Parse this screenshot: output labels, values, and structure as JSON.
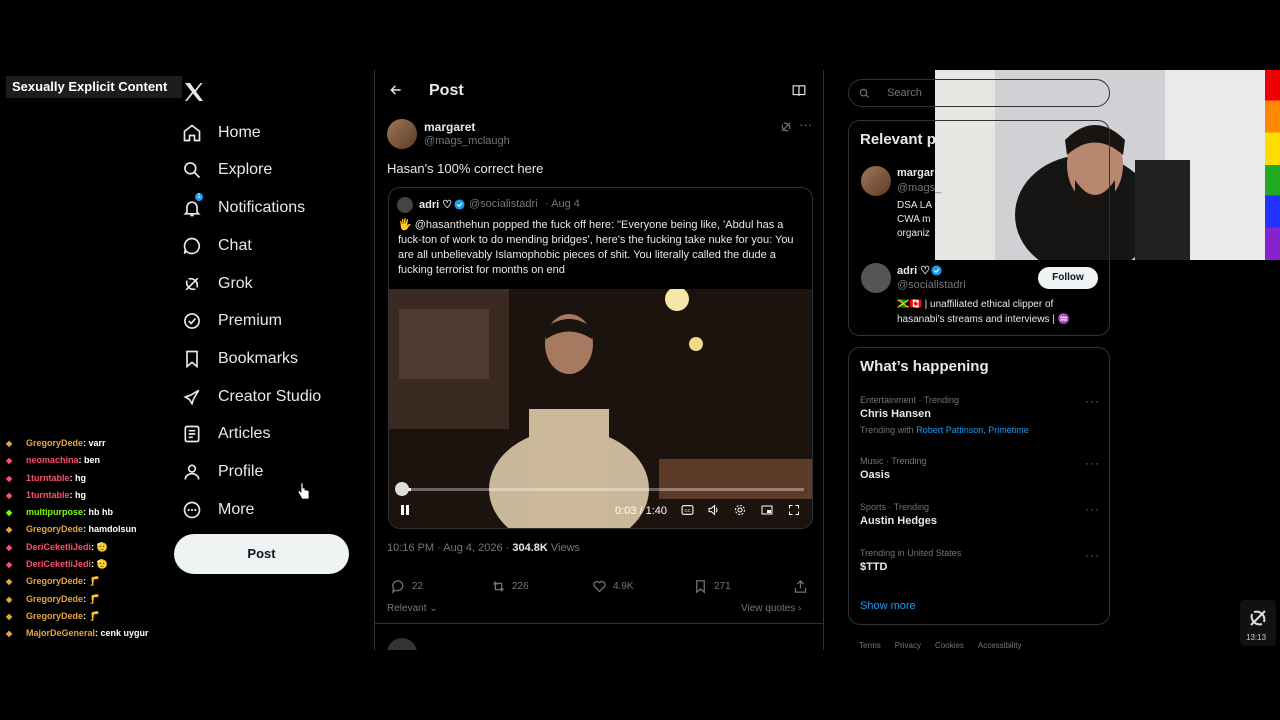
{
  "overlay": {
    "label": "Sexually Explicit Content"
  },
  "nav": {
    "items": [
      {
        "label": "Home",
        "icon": "home-icon"
      },
      {
        "label": "Explore",
        "icon": "search-icon"
      },
      {
        "label": "Notifications",
        "icon": "bell-icon",
        "badge": "1"
      },
      {
        "label": "Chat",
        "icon": "chat-icon"
      },
      {
        "label": "Grok",
        "icon": "grok-icon"
      },
      {
        "label": "Premium",
        "icon": "premium-icon"
      },
      {
        "label": "Bookmarks",
        "icon": "bookmark-icon"
      },
      {
        "label": "Creator Studio",
        "icon": "rocket-icon"
      },
      {
        "label": "Articles",
        "icon": "article-icon"
      },
      {
        "label": "Profile",
        "icon": "person-icon"
      },
      {
        "label": "More",
        "icon": "more-circle-icon"
      }
    ],
    "post_label": "Post"
  },
  "main": {
    "title": "Post",
    "author": {
      "name": "margaret",
      "handle": "@mags_mclaugh"
    },
    "text": "Hasan's 100% correct here",
    "quote": {
      "name": "adri ♡",
      "handle": "@socialistadri",
      "date": "· Aug 4",
      "text": "🖐 @hasanthehun popped the fuck off here:  \"Everyone being like, 'Abdul has a fuck-ton of work to do mending bridges', here's the fucking take nuke for you: You are all unbelievably Islamophobic pieces of shit. You literally called the dude a fucking terrorist for months on end",
      "video_time": "0:03 / 1:40",
      "video_progress": 0.03
    },
    "timestamp": "10:16 PM · Aug 4, 2026 · ",
    "views_count": "304.8K",
    "views_label": " Views",
    "stats": {
      "replies": "22",
      "reposts": "226",
      "likes": "4.9K",
      "bookmarks": "271"
    },
    "sort_label": "Relevant",
    "view_quotes": "View quotes"
  },
  "right": {
    "search_placeholder": "Search",
    "relevant_title": "Relevant p",
    "rel_people": [
      {
        "name": "margar",
        "handle": "@mags_",
        "bio": "DSA LA\nCWA m\norganiz"
      },
      {
        "name": "adri ♡",
        "handle": "@socialistadri",
        "bio": "🇯🇲🇨🇦 | unaffiliated ethical clipper of hasanabi's streams and interviews | ♒",
        "follow": "Follow"
      }
    ],
    "happening_title": "What’s happening",
    "trends": [
      {
        "category": "Entertainment · Trending",
        "name": "Chris Hansen",
        "with_label": "Trending with",
        "with_links": "Robert Pattinson, Primetime"
      },
      {
        "category": "Music · Trending",
        "name": "Oasis"
      },
      {
        "category": "Sports · Trending",
        "name": "Austin Hedges"
      },
      {
        "category": "Trending in United States",
        "name": "$TTD"
      }
    ],
    "show_more": "Show more",
    "footer": [
      "Terms",
      "Privacy",
      "Cookies",
      "Accessibility"
    ]
  },
  "chat": [
    {
      "user": "GregoryDede",
      "color": "#e8a33d",
      "msg": "varr"
    },
    {
      "user": "neomachina",
      "color": "#ff4d6d",
      "msg": "ben"
    },
    {
      "user": "1turntable",
      "color": "#ff4d6d",
      "msg": "hg"
    },
    {
      "user": "1turntable",
      "color": "#ff4d6d",
      "msg": "hg"
    },
    {
      "user": "multipurpose",
      "color": "#7cfc00",
      "msg": "hb hb"
    },
    {
      "user": "GregoryDede",
      "color": "#e8a33d",
      "msg": "hamdolsun"
    },
    {
      "user": "DeriCeketliJedi",
      "color": "#ff4d6d",
      "msg": "🫡"
    },
    {
      "user": "DeriCeketliJedi",
      "color": "#ff4d6d",
      "msg": "🫡"
    },
    {
      "user": "GregoryDede",
      "color": "#e8a33d",
      "msg": "🦵"
    },
    {
      "user": "GregoryDede",
      "color": "#e8a33d",
      "msg": "🦵"
    },
    {
      "user": "GregoryDede",
      "color": "#e8a33d",
      "msg": "🦵"
    },
    {
      "user": "MajorDeGeneral",
      "color": "#e8a33d",
      "msg": "cenk uygur"
    }
  ],
  "clock": "13:13"
}
